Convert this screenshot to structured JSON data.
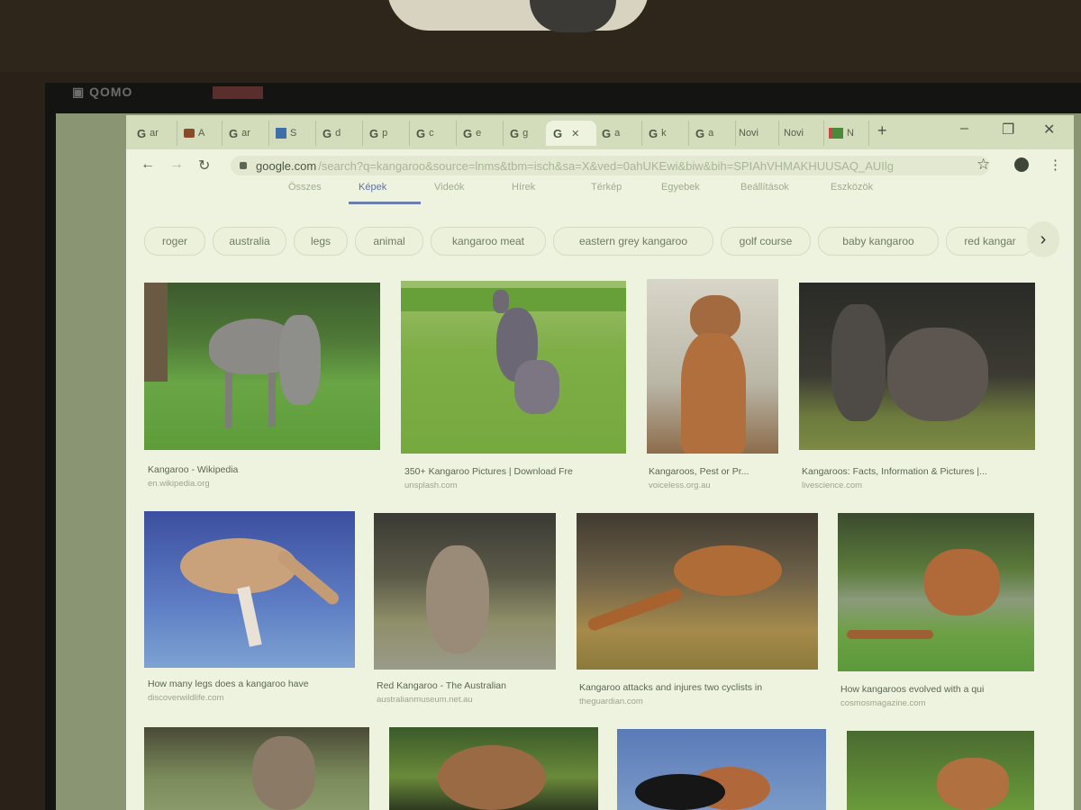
{
  "browser": {
    "tabs": [
      {
        "icon": "G",
        "label": "ar"
      },
      {
        "icon": "bag-icon",
        "label": "A"
      },
      {
        "icon": "G",
        "label": "ar"
      },
      {
        "icon": "star-badge-icon",
        "label": "S"
      },
      {
        "icon": "G",
        "label": "d"
      },
      {
        "icon": "G",
        "label": "p"
      },
      {
        "icon": "G",
        "label": "c"
      },
      {
        "icon": "G",
        "label": "e"
      },
      {
        "icon": "G",
        "label": "g"
      },
      {
        "icon": "G",
        "label": "",
        "active": true,
        "close": "✕"
      },
      {
        "icon": "G",
        "label": "a"
      },
      {
        "icon": "G",
        "label": "k"
      },
      {
        "icon": "G",
        "label": "a"
      },
      {
        "icon": "",
        "label": "Novi"
      },
      {
        "icon": "",
        "label": "Novi"
      },
      {
        "icon": "maps-icon",
        "label": "N"
      }
    ],
    "new_tab": "+",
    "url_host": "google.com",
    "url_rest": "/search?q=kangaroo&source=lnms&tbm=isch&sa=X&ved=0ahUKEwi&biw&bih=SPIAhVHMAKHUUSAQ_AUIlg"
  },
  "search_nav": {
    "items": [
      "Összes",
      "Képek",
      "Videók",
      "Hírek",
      "Térkép",
      "Egyebek",
      "Beállítások",
      "Eszközök"
    ],
    "selected": 1
  },
  "chips": [
    "roger",
    "australia",
    "legs",
    "animal",
    "kangaroo meat",
    "eastern grey kangaroo",
    "golf course",
    "baby kangaroo",
    "red kangar"
  ],
  "results": [
    {
      "title": "Kangaroo - Wikipedia",
      "source": "en.wikipedia.org"
    },
    {
      "title": "350+ Kangaroo Pictures | Download Fre",
      "source": "unsplash.com"
    },
    {
      "title": "Kangaroos, Pest or Pr...",
      "source": "voiceless.org.au"
    },
    {
      "title": "Kangaroos: Facts, Information & Pictures |...",
      "source": "livescience.com"
    },
    {
      "title": "How many legs does a kangaroo have",
      "source": "discoverwildlife.com"
    },
    {
      "title": "Red Kangaroo - The Australian",
      "source": "australianmuseum.net.au"
    },
    {
      "title": "Kangaroo attacks and injures two cyclists in",
      "source": "theguardian.com"
    },
    {
      "title": "How kangaroos evolved with a qui",
      "source": "cosmosmagazine.com"
    }
  ],
  "colors": {
    "screen_bg": "#eef3df",
    "selected_tab_accent": "#6b7faa"
  }
}
